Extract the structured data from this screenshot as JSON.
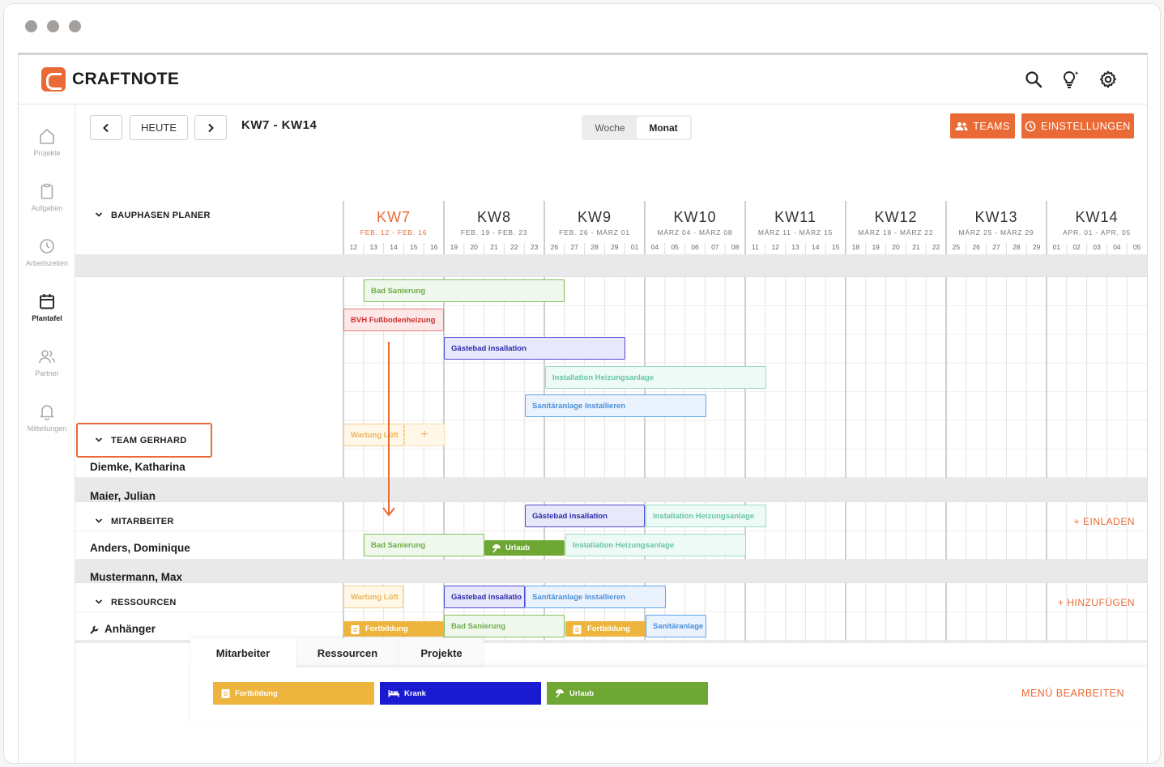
{
  "app": {
    "brand": "CRAFTNOTE"
  },
  "sidebar": {
    "items": [
      {
        "label": "Projekte",
        "icon": "home-icon"
      },
      {
        "label": "Aufgaben",
        "icon": "clipboard-icon"
      },
      {
        "label": "Arbeitszeiten",
        "icon": "clock-icon"
      },
      {
        "label": "Plantafel",
        "icon": "calendar-icon",
        "active": true
      },
      {
        "label": "Partner",
        "icon": "people-icon"
      },
      {
        "label": "Mitteilungen",
        "icon": "bell-icon"
      }
    ]
  },
  "toolbar": {
    "prev": "‹",
    "today": "HEUTE",
    "next": "›",
    "range": "KW7 - KW14",
    "view_week": "Woche",
    "view_month": "Monat",
    "teams": "TEAMS",
    "settings": "EINSTELLUNGEN"
  },
  "weeks": [
    {
      "kw": "KW7",
      "dates": "FEB. 12 - FEB. 16",
      "days": [
        "12",
        "13",
        "14",
        "15",
        "16"
      ],
      "current": true
    },
    {
      "kw": "KW8",
      "dates": "FEB. 19 - FEB. 23",
      "days": [
        "19",
        "20",
        "21",
        "22",
        "23"
      ]
    },
    {
      "kw": "KW9",
      "dates": "FEB. 26 - MÄRZ 01",
      "days": [
        "26",
        "27",
        "28",
        "29",
        "01"
      ]
    },
    {
      "kw": "KW10",
      "dates": "MÄRZ 04 - MÄRZ 08",
      "days": [
        "04",
        "05",
        "06",
        "07",
        "08"
      ]
    },
    {
      "kw": "KW11",
      "dates": "MÄRZ 11 - MÄRZ 15",
      "days": [
        "11",
        "12",
        "13",
        "14",
        "15"
      ]
    },
    {
      "kw": "KW12",
      "dates": "MÄRZ 18 - MÄRZ 22",
      "days": [
        "18",
        "19",
        "20",
        "21",
        "22"
      ]
    },
    {
      "kw": "KW13",
      "dates": "MÄRZ 25 - MÄRZ 29",
      "days": [
        "25",
        "26",
        "27",
        "28",
        "29"
      ]
    },
    {
      "kw": "KW14",
      "dates": "APR. 01 - APR. 05",
      "days": [
        "01",
        "02",
        "03",
        "04",
        "05"
      ]
    }
  ],
  "sections": {
    "bauphasen": "BAUPHASEN PLANER",
    "team": "TEAM GERHARD",
    "mitarbeiter": "MITARBEITER",
    "mitarbeiter_action": "+ EINLADEN",
    "ressourcen": "RESSOURCEN",
    "ressourcen_action": "+ HINZUFÜGEN"
  },
  "rows": {
    "team_1": "Diemke, Katharina",
    "team_2": "Maier, Julian",
    "emp_1": "Anders, Dominique",
    "emp_2": "Mustermann, Max",
    "res_1": "Anhänger"
  },
  "tasks": {
    "bad_sanierung": "Bad Sanierung",
    "bvh": "BVH Fußbodenheizung",
    "gaestebad": "Gästebad insallation",
    "heizung": "Installation Heizungsanlage",
    "sanitaer": "Sanitäranlage Installieren",
    "wartung": "Wartung Lüft",
    "urlaub": "Urlaub",
    "fortbildung": "Fortbildung",
    "gaestebad_short": "Gästebad insallatio",
    "sanitaer_short": "Sanitäranlage"
  },
  "bottom": {
    "tabs": [
      "Mitarbeiter",
      "Ressourcen",
      "Projekte"
    ],
    "chips": [
      "Fortbildung",
      "Krank",
      "Urlaub"
    ],
    "menu_edit": "MENÜ BEARBEITEN"
  },
  "colors": {
    "accent": "#ea6a35",
    "fortbildung": "#edb53e",
    "krank": "#1a1ad1",
    "urlaub": "#6ea733"
  }
}
